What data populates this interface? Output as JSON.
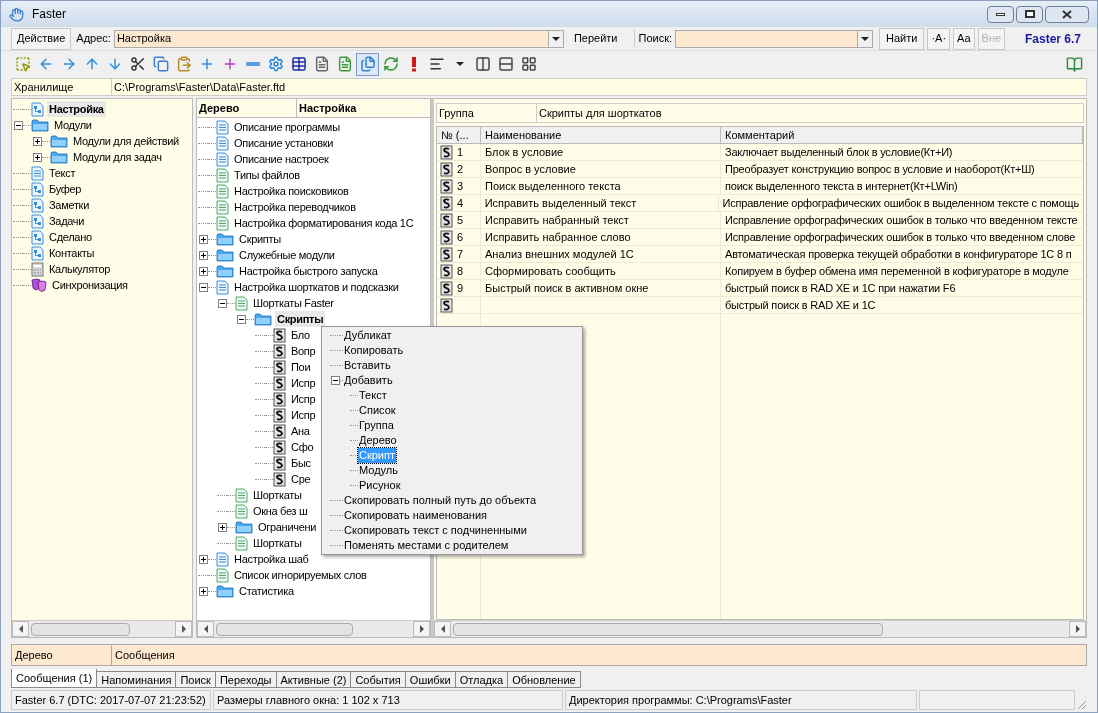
{
  "window": {
    "title": "Faster"
  },
  "address_bar": {
    "action_button": "Действие",
    "address_label": "Адрес:",
    "address_value": "Настройка",
    "go_button": "Перейти",
    "search_label": "Поиск:",
    "find_button": "Найти",
    "case_button": "·A·",
    "match_button": "Aa",
    "outside_button": "Вне",
    "outside_disabled": true,
    "version": "Faster 6.7"
  },
  "toolbar": [
    {
      "kind": "select",
      "pressed": false
    },
    {
      "kind": "back",
      "pressed": false
    },
    {
      "kind": "forward",
      "pressed": false
    },
    {
      "kind": "up",
      "pressed": false
    },
    {
      "kind": "down",
      "pressed": false
    },
    {
      "kind": "cut",
      "pressed": false
    },
    {
      "kind": "copy",
      "pressed": false
    },
    {
      "kind": "paste",
      "pressed": false
    },
    {
      "kind": "add",
      "pressed": false
    },
    {
      "kind": "add-child",
      "pressed": false
    },
    {
      "kind": "remove",
      "pressed": false
    },
    {
      "kind": "settings",
      "pressed": false
    },
    {
      "kind": "table",
      "pressed": false
    },
    {
      "kind": "doc",
      "pressed": false
    },
    {
      "kind": "list",
      "pressed": false
    },
    {
      "kind": "tree",
      "pressed": true
    },
    {
      "kind": "refresh",
      "pressed": false
    },
    {
      "kind": "alert",
      "pressed": false
    },
    {
      "kind": "format",
      "pressed": false
    },
    {
      "kind": "dropdown",
      "pressed": false
    },
    {
      "kind": "split-a",
      "pressed": false
    },
    {
      "kind": "split-b",
      "pressed": false
    },
    {
      "kind": "split-c",
      "pressed": false
    }
  ],
  "storage": {
    "label": "Хранилище",
    "path": "C:\\Programs\\Faster\\Data\\Faster.ftd"
  },
  "left_tree": [
    {
      "label": "Настройка",
      "kind": "tree",
      "selected": true
    },
    {
      "label": "Модули",
      "kind": "folder",
      "expanded": true,
      "selected": false,
      "children": [
        {
          "label": "Модули для действий",
          "kind": "folder",
          "expanded": false,
          "selected": false
        },
        {
          "label": "Модули для задач",
          "kind": "folder",
          "expanded": false,
          "selected": false
        }
      ]
    },
    {
      "label": "Текст",
      "kind": "text",
      "selected": false
    },
    {
      "label": "Буфер",
      "kind": "tree",
      "selected": false
    },
    {
      "label": "Заметки",
      "kind": "tree",
      "selected": false
    },
    {
      "label": "Задачи",
      "kind": "tree",
      "selected": false
    },
    {
      "label": "Сделано",
      "kind": "tree",
      "selected": false
    },
    {
      "label": "Контакты",
      "kind": "tree",
      "selected": false
    },
    {
      "label": "Калькулятор",
      "kind": "calc",
      "selected": false
    },
    {
      "label": "Синхронизация",
      "kind": "sync",
      "selected": false
    }
  ],
  "middle_header": [
    "Дерево",
    "Настройка"
  ],
  "middle_tree": [
    {
      "label": "Описание программы",
      "kind": "text",
      "selected": false
    },
    {
      "label": "Описание установки",
      "kind": "text",
      "selected": false
    },
    {
      "label": "Описание настроек",
      "kind": "text",
      "selected": false
    },
    {
      "label": "Типы файлов",
      "kind": "list",
      "selected": false
    },
    {
      "label": "Настройка поисковиков",
      "kind": "list",
      "selected": false
    },
    {
      "label": "Настройка переводчиков",
      "kind": "list",
      "selected": false
    },
    {
      "label": "Настройка форматирования кода 1С",
      "kind": "list",
      "selected": false
    },
    {
      "label": "Скрипты",
      "kind": "folder",
      "expanded": false,
      "selected": false
    },
    {
      "label": "Служебные модули",
      "kind": "folder",
      "expanded": false,
      "selected": false
    },
    {
      "label": "Настройка быстрого запуска",
      "kind": "folder",
      "expanded": false,
      "selected": false
    },
    {
      "label": "Настройка шорткатов и подсказки",
      "kind": "text",
      "expanded": true,
      "selected": false,
      "children": [
        {
          "label": "Шорткаты Faster",
          "kind": "list",
          "expanded": true,
          "selected": false,
          "children": [
            {
              "label": "Скрипты",
              "kind": "folder",
              "expanded": true,
              "selected": true,
              "children": [
                {
                  "label": "Бло",
                  "kind": "script",
                  "selected": false
                },
                {
                  "label": "Вопр",
                  "kind": "script",
                  "selected": false
                },
                {
                  "label": "Пои",
                  "kind": "script",
                  "selected": false
                },
                {
                  "label": "Испр",
                  "kind": "script",
                  "selected": false
                },
                {
                  "label": "Испр",
                  "kind": "script",
                  "selected": false
                },
                {
                  "label": "Испр",
                  "kind": "script",
                  "selected": false
                },
                {
                  "label": "Ана",
                  "kind": "script",
                  "selected": false
                },
                {
                  "label": "Сфо",
                  "kind": "script",
                  "selected": false
                },
                {
                  "label": "Быс",
                  "kind": "script",
                  "selected": false
                },
                {
                  "label": "Сре",
                  "kind": "script",
                  "selected": false
                }
              ]
            }
          ]
        },
        {
          "label": "Шорткаты",
          "kind": "list",
          "selected": false
        },
        {
          "label": "Окна без ш",
          "kind": "list",
          "selected": false
        },
        {
          "label": "Ограничени",
          "kind": "folder",
          "expanded": false,
          "selected": false
        },
        {
          "label": "Шорткаты",
          "kind": "list",
          "selected": false
        }
      ]
    },
    {
      "label": "Настройка шаб",
      "kind": "text",
      "expanded": false,
      "selected": false
    },
    {
      "label": "Список игнорируемых слов",
      "kind": "list",
      "selected": false
    },
    {
      "label": "Статистика",
      "kind": "folder",
      "expanded": false,
      "selected": false
    }
  ],
  "group": {
    "label": "Группа",
    "value": "Скрипты для шорткатов"
  },
  "table": {
    "columns": [
      "№ (...",
      "Наименование",
      "Комментарий"
    ],
    "rows": [
      {
        "number": "1",
        "name": "Блок в условие",
        "comment": "Заключает выделенный блок в условие(Кт+И)"
      },
      {
        "number": "2",
        "name": "Вопрос в условие",
        "comment": "Преобразует конструкцию вопрос в условие и наоборот(Кт+Ш)"
      },
      {
        "number": "3",
        "name": "Поиск выделенного текста",
        "comment": "поиск выделенного текста в интернет(Кт+LWin)"
      },
      {
        "number": "4",
        "name": "Исправить выделенный текст",
        "comment": "Исправление орфографических ошибок в выделенном тексте с помощь"
      },
      {
        "number": "5",
        "name": "Исправить набранный текст",
        "comment": "Исправление орфографических ошибок в только что введенном тексте"
      },
      {
        "number": "6",
        "name": "Исправить набранное слово",
        "comment": "Исправление орфографических ошибок в только что введенном слове"
      },
      {
        "number": "7",
        "name": "Анализ внешних модулей 1С",
        "comment": "Автоматическая проверка текущей обработки в конфигураторе 1С 8 п"
      },
      {
        "number": "8",
        "name": "Сформировать сообщить",
        "comment": "Копируем в буфер обмена имя переменной в кофигураторе в модуле"
      },
      {
        "number": "9",
        "name": "Быстрый поиск в активном окне",
        "comment": "быстрый поиск в RAD XE и 1С при нажатии F6"
      },
      {
        "comment": "быстрый поиск в RAD XE и 1С"
      }
    ]
  },
  "context_menu": [
    {
      "label": "Дубликат",
      "selected": false
    },
    {
      "label": "Копировать",
      "selected": false
    },
    {
      "label": "Вставить",
      "selected": false
    },
    {
      "label": "Добавить",
      "selected": false,
      "expanded": true,
      "children": [
        {
          "label": "Текст",
          "selected": false
        },
        {
          "label": "Список",
          "selected": false
        },
        {
          "label": "Группа",
          "selected": false
        },
        {
          "label": "Дерево",
          "selected": false
        },
        {
          "label": "Скрипт",
          "selected": true
        },
        {
          "label": "Модуль",
          "selected": false
        },
        {
          "label": "Рисунок",
          "selected": false
        }
      ]
    },
    {
      "label": "Скопировать полный путь до объекта",
      "selected": false
    },
    {
      "label": "Скопировать наименования",
      "selected": false
    },
    {
      "label": "Скопировать текст с подчиненными",
      "selected": false
    },
    {
      "label": "Поменять местами с родителем",
      "selected": false
    }
  ],
  "messages_header": [
    "Дерево",
    "Сообщения"
  ],
  "bottom_tabs": [
    {
      "label": "Сообщения (1)",
      "selected": true
    },
    {
      "label": "Напоминания",
      "selected": false
    },
    {
      "label": "Поиск",
      "selected": false
    },
    {
      "label": "Переходы",
      "selected": false
    },
    {
      "label": "Активные (2)",
      "selected": false
    },
    {
      "label": "События",
      "selected": false
    },
    {
      "label": "Ошибки",
      "selected": false
    },
    {
      "label": "Отладка",
      "selected": false
    },
    {
      "label": "Обновление",
      "selected": false
    }
  ],
  "status_bar": [
    "Faster 6.7 (DTC: 2017-07-07 21:23:52)",
    "Размеры главного окна: 1 102 x 713",
    "Директория программы: C:\\Programs\\Faster"
  ]
}
